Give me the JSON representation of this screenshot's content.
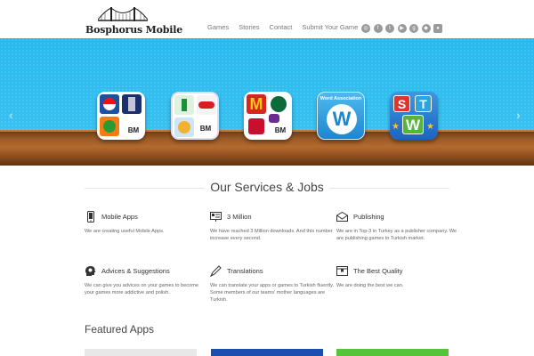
{
  "brand": {
    "name": "Bosphorus Mobile"
  },
  "nav": {
    "items": [
      "Games",
      "Stories",
      "Contact",
      "Submit Your Game"
    ]
  },
  "social": [
    "rss-icon",
    "facebook-icon",
    "twitter-icon",
    "youtube-icon",
    "google-plus-icon",
    "android-icon",
    "apple-icon"
  ],
  "slider": {
    "apps": [
      {
        "name": "brand-logo-quiz-pepsi-icon",
        "badge": "BM"
      },
      {
        "name": "brand-logo-quiz-nutella-icon",
        "badge": "BM"
      },
      {
        "name": "brand-logo-quiz-mcdonalds-icon",
        "badge": "BM"
      },
      {
        "name": "word-association-icon",
        "caption": "Word Association",
        "letter": "W"
      },
      {
        "name": "stw-icon",
        "letters": [
          "S",
          "T",
          "W"
        ]
      }
    ],
    "prev": "‹",
    "next": "›"
  },
  "services": {
    "title": "Our Services & Jobs",
    "items": [
      {
        "title": "Mobile Apps",
        "text": "We are creating useful Mobile Apps."
      },
      {
        "title": "3 Million",
        "text": "We have reached 3 Million downloads. And this number increase every second."
      },
      {
        "title": "Publishing",
        "text": "We are in Top-3 in Turkey as a publisher company. We are publishing games to Turkish market."
      },
      {
        "title": "Advices & Suggestions",
        "text": "We can give you advices on your games to become your games more addictive and polish."
      },
      {
        "title": "Translations",
        "text": "We can translate your apps or games to Turkish fluently. Some members of our teams' mother languages are Turkish."
      },
      {
        "title": "The Best Quality",
        "text": "We are doing the best we can."
      }
    ]
  },
  "featured": {
    "title": "Featured Apps"
  },
  "colors": {
    "sky": "#2fbdf0",
    "shelf": "#a05e28",
    "text": "#555555"
  }
}
